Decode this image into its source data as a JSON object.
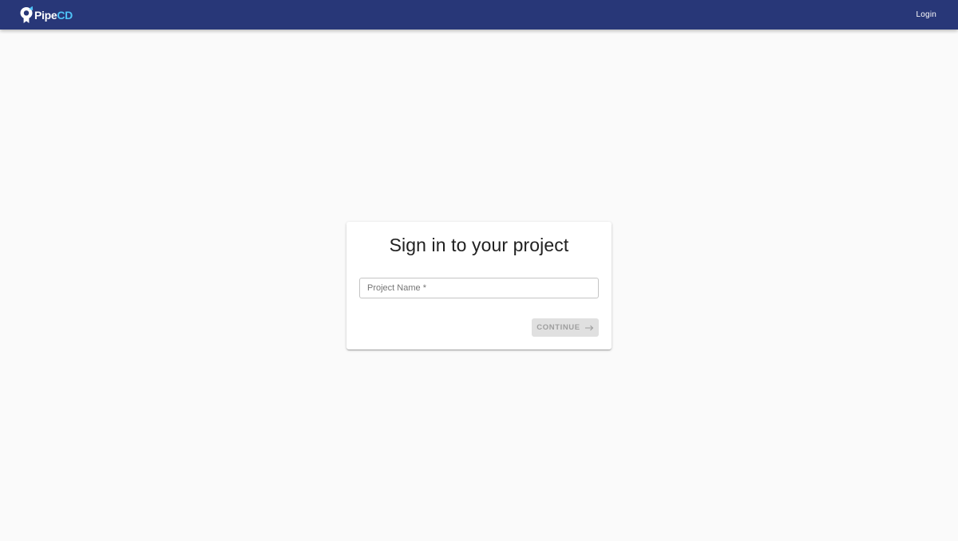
{
  "header": {
    "logo_text": "Pipe",
    "logo_text_accent": "CD",
    "login_label": "Login"
  },
  "signin": {
    "title": "Sign in to your project",
    "project_name_placeholder": "Project Name *",
    "project_name_value": "",
    "continue_label": "CONTINUE"
  },
  "icons": {
    "logo": "pipecd-logo-icon",
    "continue": "arrow-right-icon"
  },
  "colors": {
    "appbar": "#283778",
    "background": "#fafafa",
    "logo_accent": "#4fc3f7",
    "button_disabled_bg": "#e0e0e0",
    "button_disabled_text": "#9e9e9e"
  }
}
